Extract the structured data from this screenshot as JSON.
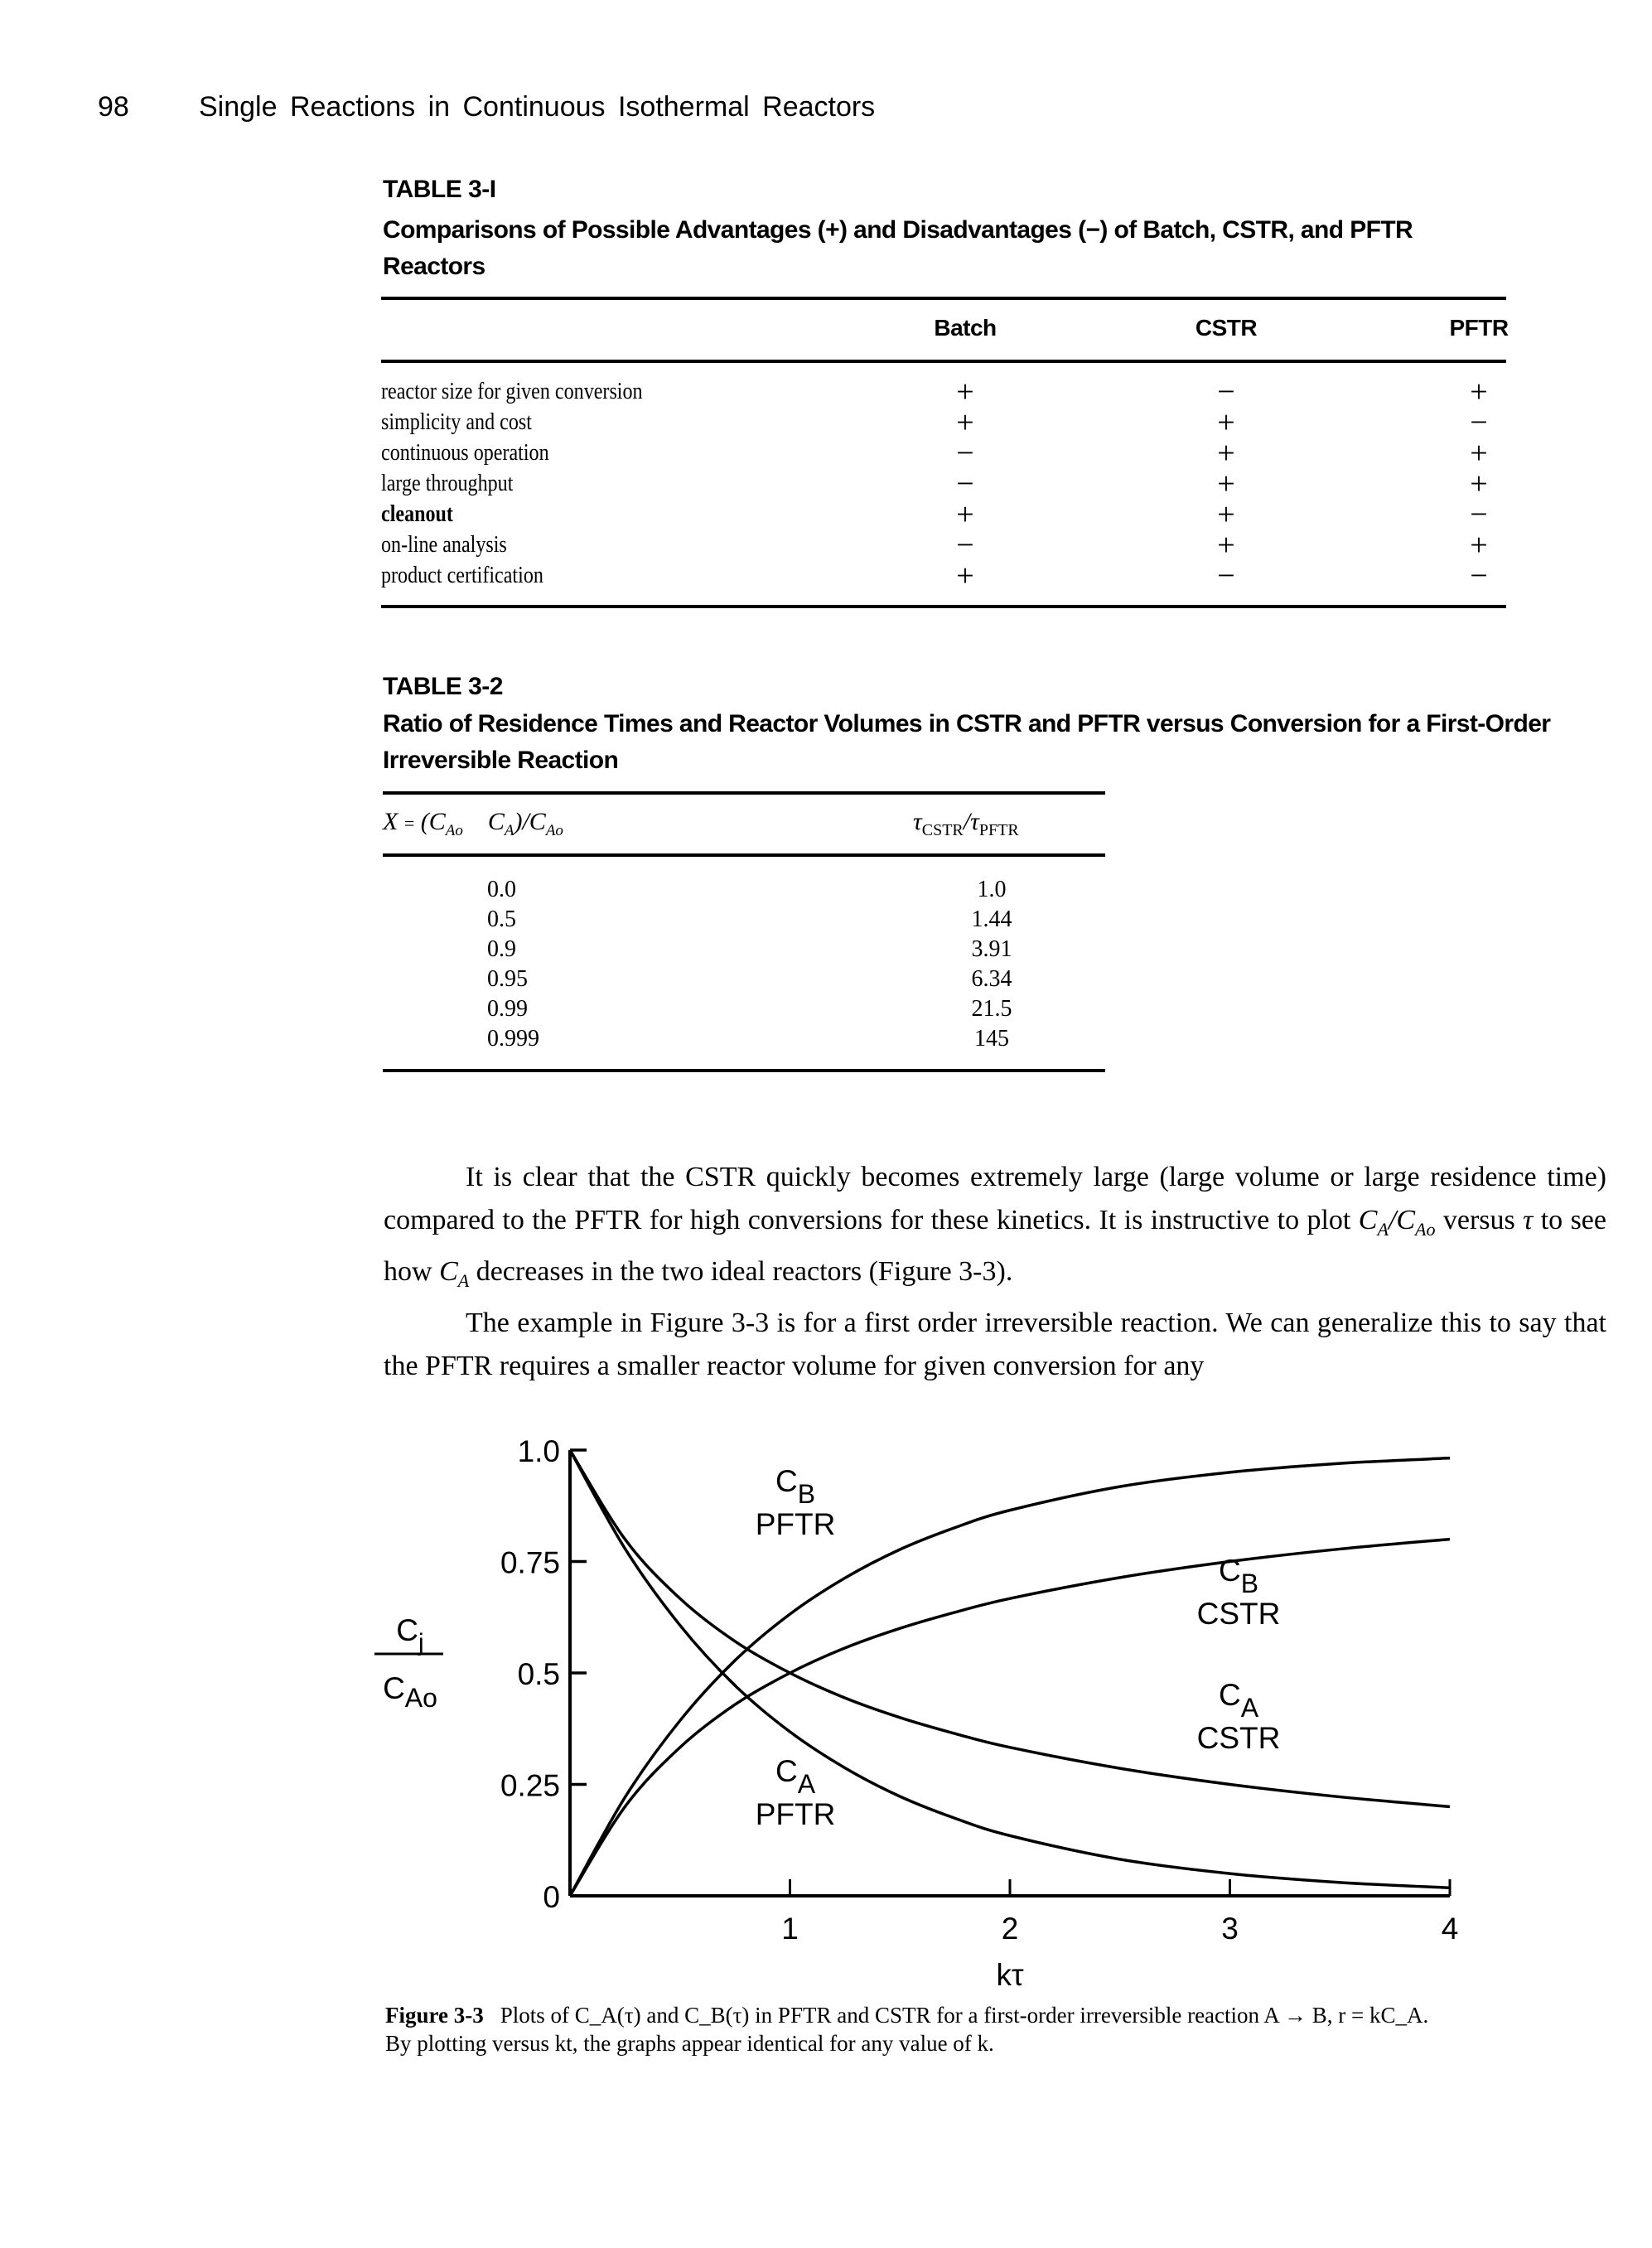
{
  "header": {
    "page_number": "98",
    "running_title": "Single Reactions in Continuous Isothermal Reactors"
  },
  "table_3_1": {
    "label": "TABLE 3-I",
    "title": "Comparisons of Possible Advantages (+) and Disadvantages (−) of Batch, CSTR, and PFTR Reactors",
    "columns": [
      "",
      "Batch",
      "CSTR",
      "PFTR"
    ],
    "rows": [
      {
        "label": "reactor size for given conversion",
        "batch": "+",
        "cstr": "−",
        "pftr": "+"
      },
      {
        "label": "simplicity and cost",
        "batch": "+",
        "cstr": "+",
        "pftr": "−"
      },
      {
        "label": "continuous operation",
        "batch": "−",
        "cstr": "+",
        "pftr": "+"
      },
      {
        "label": "large throughput",
        "batch": "−",
        "cstr": "+",
        "pftr": "+"
      },
      {
        "label": "cleanout",
        "batch": "+",
        "cstr": "+",
        "pftr": "−"
      },
      {
        "label": "on-line analysis",
        "batch": "−",
        "cstr": "+",
        "pftr": "+"
      },
      {
        "label": "product certification",
        "batch": "+",
        "cstr": "−",
        "pftr": "−"
      }
    ]
  },
  "table_3_2": {
    "label": "TABLE 3-2",
    "title": "Ratio of Residence Times and Reactor Volumes in CSTR and PFTR versus Conversion for a First-Order Irreversible Reaction",
    "col_x": "X = (C_Ao − C_A)/C_Ao",
    "col_ratio": "τ_CSTR / τ_PFTR",
    "rows": [
      {
        "x": "0.0",
        "ratio": "1.0"
      },
      {
        "x": "0.5",
        "ratio": "1.44"
      },
      {
        "x": "0.9",
        "ratio": "3.91"
      },
      {
        "x": "0.95",
        "ratio": "6.34"
      },
      {
        "x": "0.99",
        "ratio": "21.5"
      },
      {
        "x": "0.999",
        "ratio": "145"
      }
    ]
  },
  "body": {
    "p1_a": "It is clear that the CSTR quickly becomes extremely large (large volume or large residence time) compared to the PFTR for high conversions for these kinetics. It is instructive to plot ",
    "p1_b": " versus ",
    "p1_c": " to see how ",
    "p1_d": " decreases in the two ideal reactors (Figure 3-3).",
    "p2": "The example in Figure 3-3 is for a first order irreversible reaction. We can generalize this to say that the PFTR requires a smaller reactor volume for given conversion for any"
  },
  "figure": {
    "caption_label": "Figure 3-3",
    "caption_text_1": "Plots of C_A(τ) and C_B(τ) in PFTR and CSTR for a first-order irreversible reaction A → B, r = kC_A.",
    "caption_text_2": "By plotting versus kt, the graphs appear identical for any value of k."
  },
  "chart_data": {
    "type": "line",
    "title": "",
    "xlabel": "kτ",
    "ylabel": "C_j / C_Ao",
    "xlim": [
      0,
      4
    ],
    "ylim": [
      0,
      1.0
    ],
    "x_ticks": [
      "1",
      "2",
      "3",
      "4"
    ],
    "y_ticks": [
      "0",
      "0.25",
      "0.5",
      "0.75",
      "1.0"
    ],
    "grid": false,
    "legend": "inline-labels",
    "x": [
      0,
      0.25,
      0.5,
      0.75,
      1,
      1.25,
      1.5,
      1.75,
      2,
      2.5,
      3,
      3.5,
      4
    ],
    "series": [
      {
        "name": "C_A PFTR",
        "label_top": "C",
        "label_sub": "A",
        "label_bottom": "PFTR",
        "values": [
          1,
          0.779,
          0.607,
          0.472,
          0.368,
          0.287,
          0.223,
          0.174,
          0.135,
          0.082,
          0.05,
          0.03,
          0.018
        ]
      },
      {
        "name": "C_B PFTR",
        "label_top": "C",
        "label_sub": "B",
        "label_bottom": "PFTR",
        "values": [
          0,
          0.221,
          0.393,
          0.528,
          0.632,
          0.713,
          0.777,
          0.826,
          0.865,
          0.918,
          0.95,
          0.97,
          0.982
        ]
      },
      {
        "name": "C_A CSTR",
        "label_top": "C",
        "label_sub": "A",
        "label_bottom": "CSTR",
        "values": [
          1,
          0.8,
          0.667,
          0.571,
          0.5,
          0.444,
          0.4,
          0.364,
          0.333,
          0.286,
          0.25,
          0.222,
          0.2
        ]
      },
      {
        "name": "C_B CSTR",
        "label_top": "C",
        "label_sub": "B",
        "label_bottom": "CSTR",
        "values": [
          0,
          0.2,
          0.333,
          0.429,
          0.5,
          0.556,
          0.6,
          0.636,
          0.667,
          0.714,
          0.75,
          0.778,
          0.8
        ]
      }
    ]
  }
}
